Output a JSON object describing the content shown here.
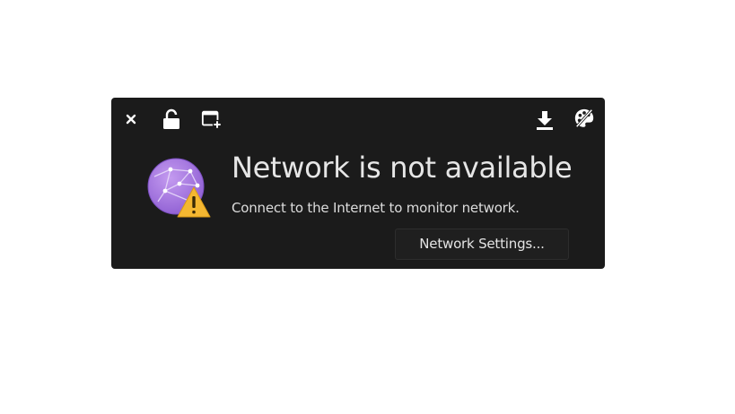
{
  "toolbar": {
    "left_icons": [
      "close-icon",
      "lock-icon",
      "new-window-icon"
    ],
    "right_icons": [
      "download-icon",
      "palette-icon"
    ]
  },
  "status": {
    "icon": "network-globe-warning-icon",
    "title": "Network is not available",
    "message": "Connect to the Internet to monitor network.",
    "button_label": "Network Settings..."
  },
  "colors": {
    "background": "#1b1b1b",
    "globe": "#a77de0",
    "warning": "#f4b731",
    "text": "#e6e6e6"
  }
}
